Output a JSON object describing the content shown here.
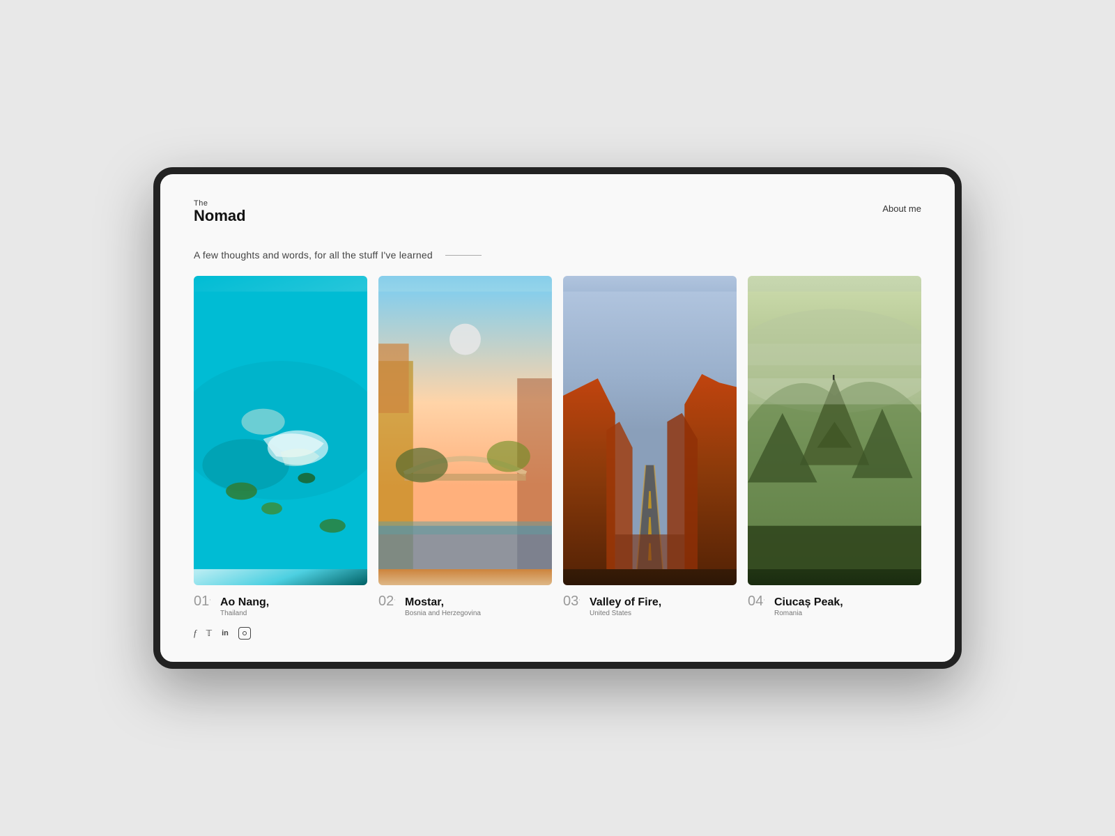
{
  "device": {
    "background": "#e8e8e8"
  },
  "header": {
    "logo_the": "The",
    "logo_nomad": "Nomad",
    "nav_about": "About me"
  },
  "tagline": {
    "text": "A few thoughts and words, for all the stuff I've learned"
  },
  "cards": [
    {
      "number": "01",
      "title": "Ao Nang,",
      "subtitle": "Thailand",
      "image_class": "ao-nang"
    },
    {
      "number": "02",
      "title": "Mostar,",
      "subtitle": "Bosnia and Herzegovina",
      "image_class": "mostar"
    },
    {
      "number": "03",
      "title": "Valley of Fire,",
      "subtitle": "United States",
      "image_class": "valley-of-fire"
    },
    {
      "number": "04",
      "title": "Ciucaș Peak,",
      "subtitle": "Romania",
      "image_class": "ciucas"
    }
  ],
  "social": [
    {
      "icon": "f",
      "name": "facebook",
      "label": "f"
    },
    {
      "icon": "𝕏",
      "name": "twitter",
      "label": "𝕋"
    },
    {
      "icon": "in",
      "name": "linkedin",
      "label": "in"
    },
    {
      "icon": "⊙",
      "name": "instagram",
      "label": "◎"
    }
  ]
}
